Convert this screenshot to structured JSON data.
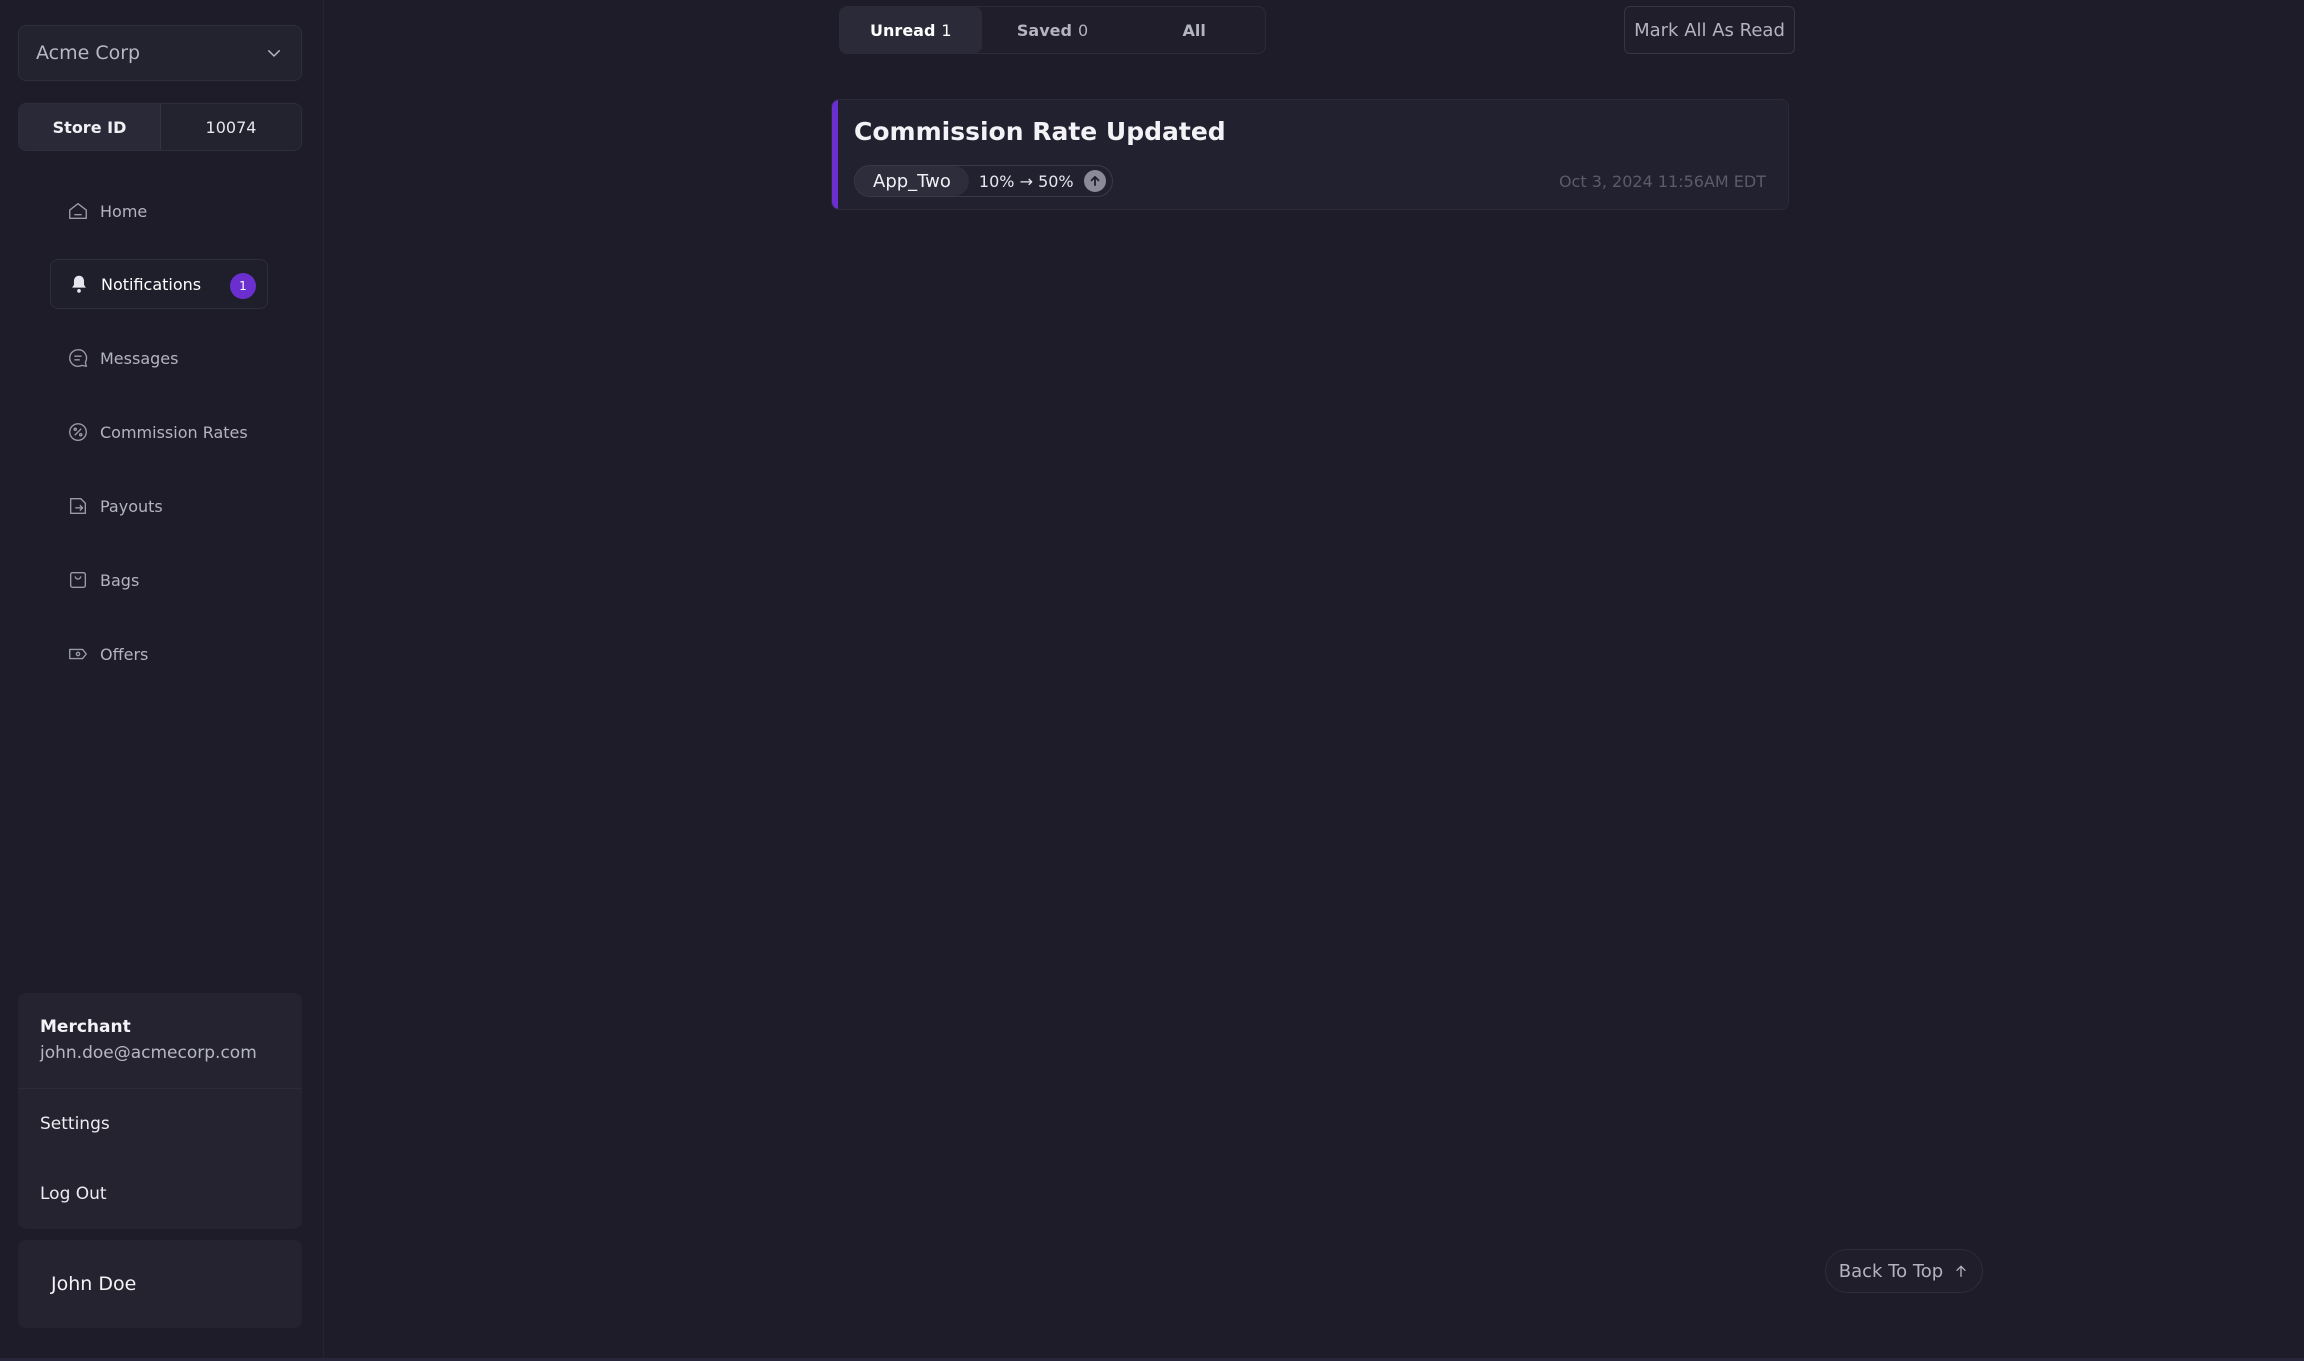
{
  "sidebar": {
    "org": {
      "name": "Acme Corp",
      "icon": "chevron-down-icon"
    },
    "store": {
      "label": "Store ID",
      "value": "10074"
    },
    "nav": [
      {
        "label": "Home",
        "icon": "home-icon"
      },
      {
        "label": "Notifications",
        "icon": "bell-icon",
        "badge": "1",
        "active": true
      },
      {
        "label": "Messages",
        "icon": "message-icon"
      },
      {
        "label": "Commission Rates",
        "icon": "percent-icon"
      },
      {
        "label": "Payouts",
        "icon": "payout-icon"
      },
      {
        "label": "Bags",
        "icon": "bag-icon"
      },
      {
        "label": "Offers",
        "icon": "ticket-icon"
      }
    ],
    "account": {
      "role": "Merchant",
      "email": "john.doe@acmecorp.com",
      "settings_label": "Settings",
      "logout_label": "Log Out"
    },
    "user_name": "John Doe"
  },
  "main": {
    "tabs": [
      {
        "name": "Unread",
        "count": "1",
        "active": true
      },
      {
        "name": "Saved",
        "count": "0"
      },
      {
        "name": "All",
        "count": ""
      }
    ],
    "mark_all_label": "Mark All As Read",
    "notifications": [
      {
        "title": "Commission Rate Updated",
        "app": "App_Two",
        "rate_change": "10% → 50%",
        "direction_icon": "arrow-up-icon",
        "timestamp": "Oct 3, 2024 11:56AM EDT"
      }
    ],
    "back_to_top_label": "Back To Top"
  },
  "colors": {
    "background": "#1d1c28",
    "accent": "#6b2fd0",
    "panel": "#24232f"
  }
}
